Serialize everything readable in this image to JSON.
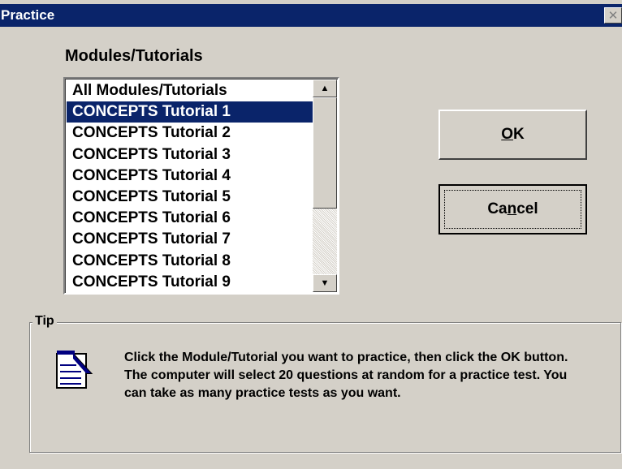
{
  "window": {
    "title": "Practice",
    "close_glyph": "✕"
  },
  "modules": {
    "label": "Modules/Tutorials",
    "items": [
      "All Modules/Tutorials",
      "CONCEPTS Tutorial 1",
      "CONCEPTS Tutorial 2",
      "CONCEPTS Tutorial 3",
      "CONCEPTS Tutorial 4",
      "CONCEPTS Tutorial 5",
      "CONCEPTS Tutorial 6",
      "CONCEPTS Tutorial 7",
      "CONCEPTS Tutorial 8",
      "CONCEPTS Tutorial 9"
    ],
    "selected_index": 1
  },
  "buttons": {
    "ok_underlined": "O",
    "ok_rest": "K",
    "cancel_before": "Ca",
    "cancel_underlined": "n",
    "cancel_after": "cel"
  },
  "tip": {
    "label": "Tip",
    "icon": "notepad-icon",
    "text": "Click the Module/Tutorial you want to practice, then click the OK button.  The computer will select 20 questions at random for a practice test.  You can take as many practice tests as you want."
  },
  "colors": {
    "titlebar": "#0a246a",
    "selection": "#0a246a",
    "face": "#d4d0c8"
  }
}
